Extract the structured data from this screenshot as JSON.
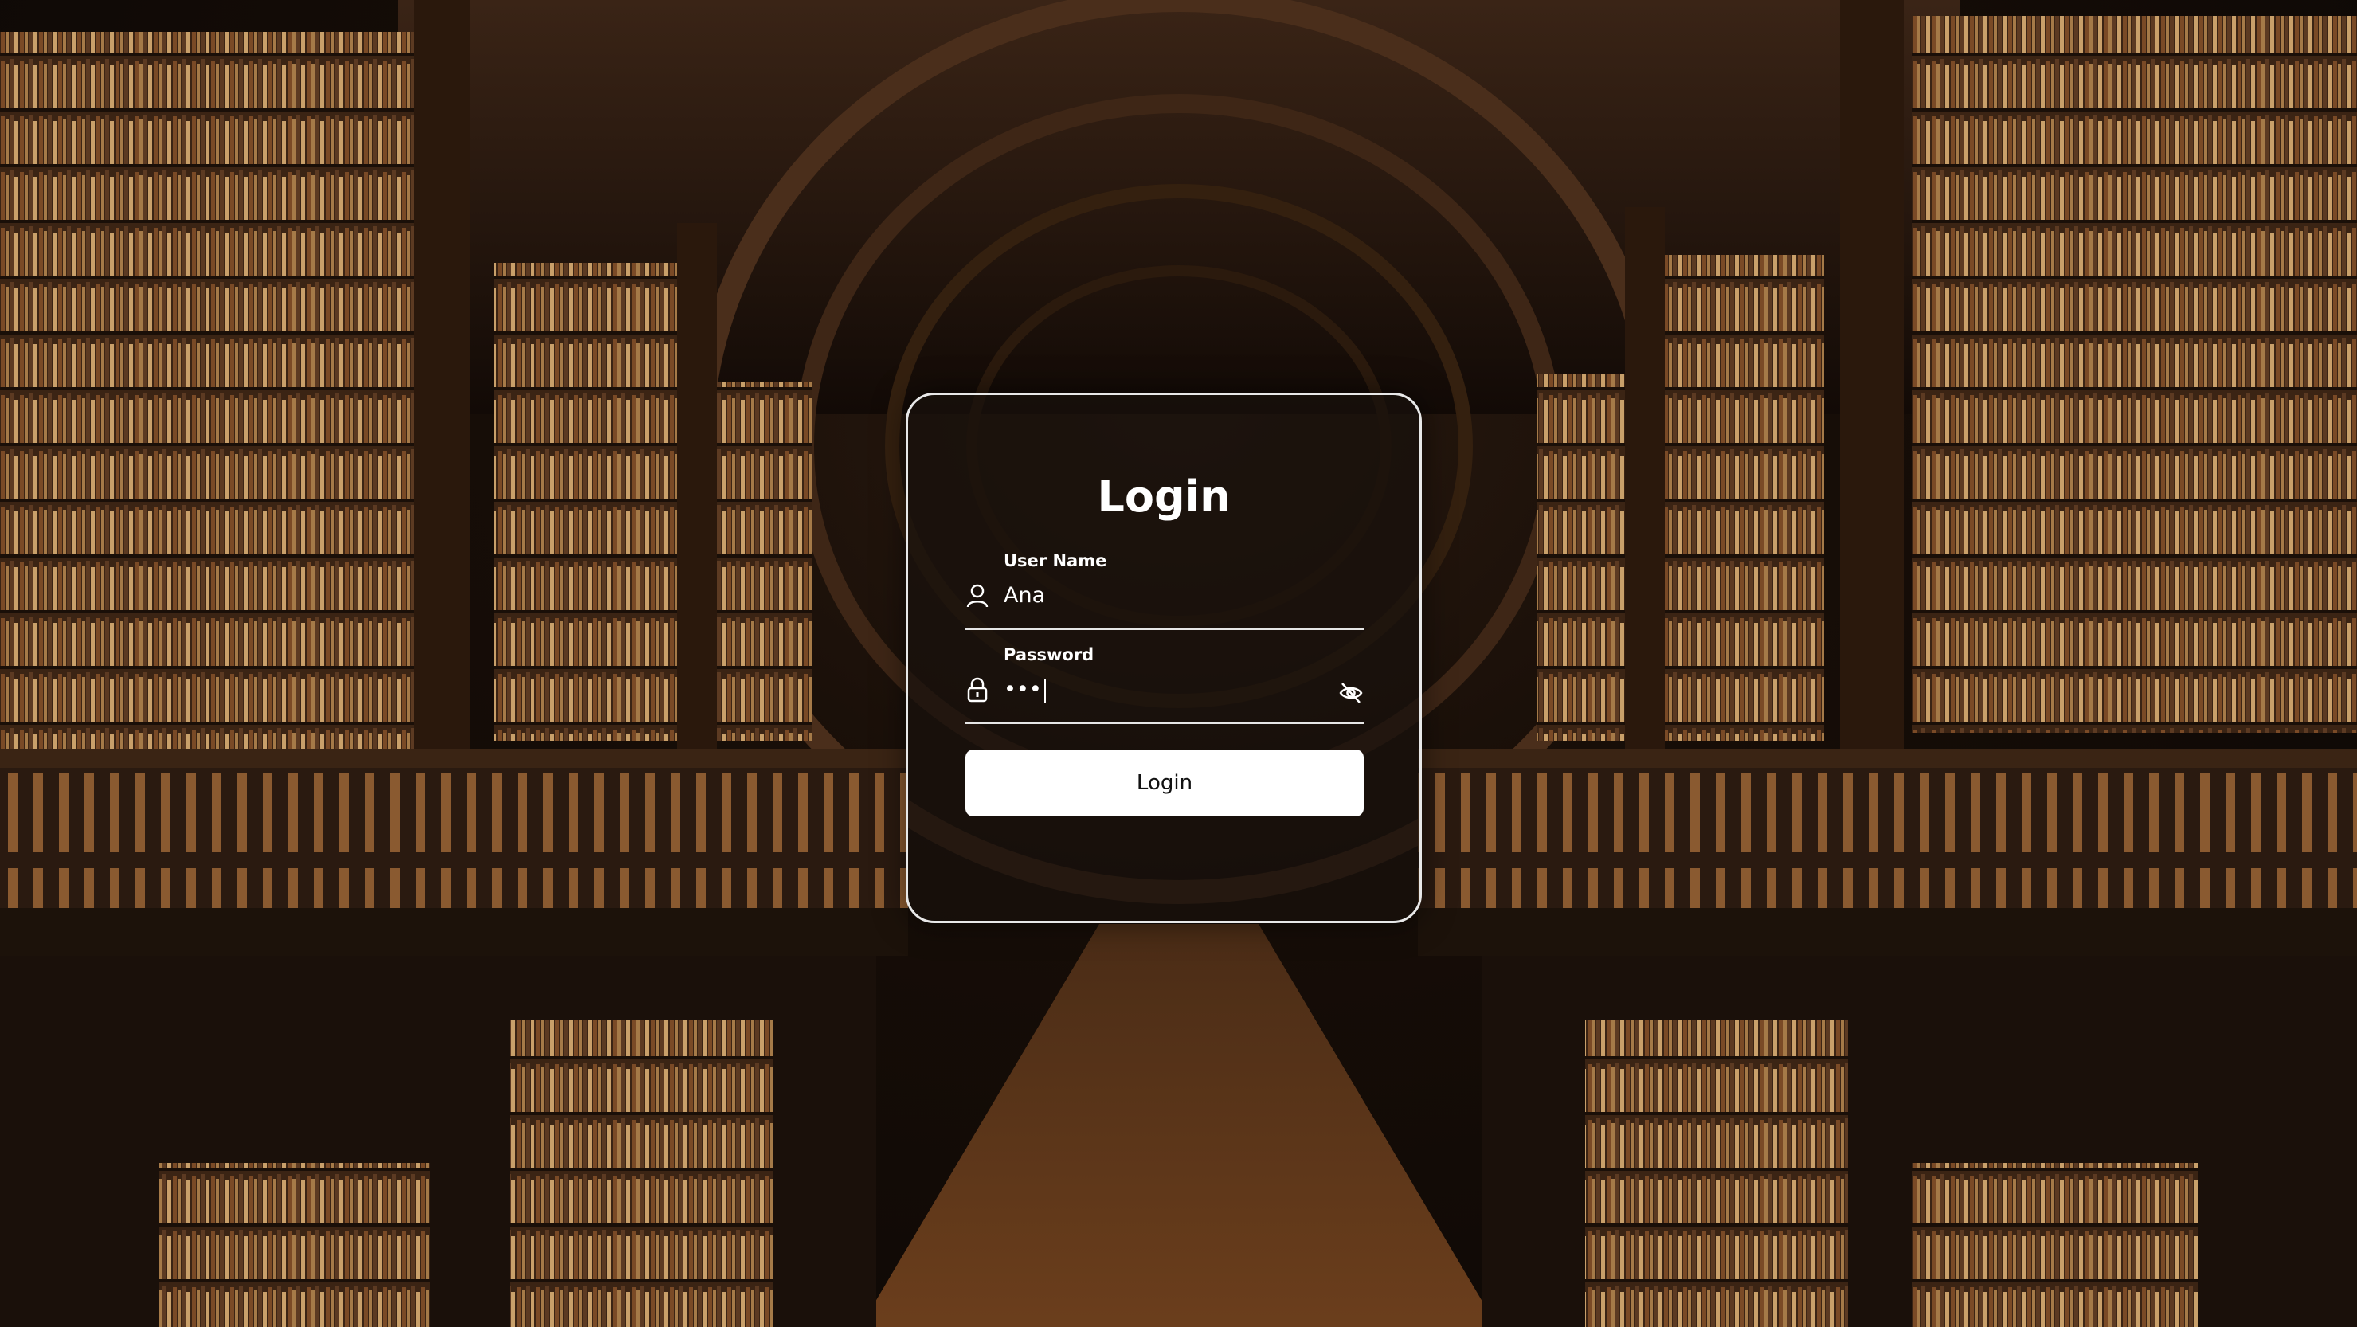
{
  "login": {
    "title": "Login",
    "username": {
      "label": "User Name",
      "value": "Ana",
      "icon": "user-icon"
    },
    "password": {
      "label": "Password",
      "value": "•••",
      "icon": "lock-icon",
      "toggle_icon": "eye-off-icon"
    },
    "submit_label": "Login"
  },
  "colors": {
    "card_border": "#e8e8e8",
    "text": "#ffffff",
    "button_bg": "#ffffff",
    "button_text": "#111111"
  }
}
